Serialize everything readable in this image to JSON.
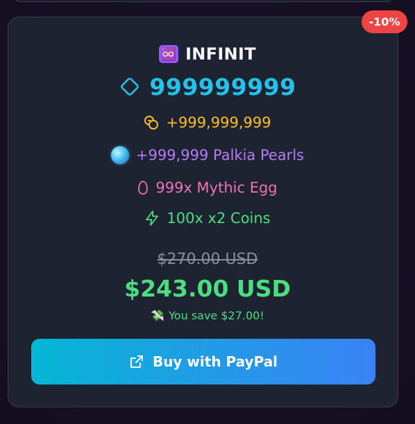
{
  "card": {
    "discount_badge": "-10%",
    "title_emoji": "♾️",
    "title": "INFINIT",
    "gems": "999999999",
    "coins": "+999,999,999",
    "pearls": "+999,999 Palkia Pearls",
    "eggs": "999x Mythic Egg",
    "multiplier": "100x x2 Coins",
    "old_price": "$270.00 USD",
    "new_price": "$243.00 USD",
    "savings_emoji": "💸",
    "savings": "You save $27.00!",
    "buy_button_label": "Buy with PayPal"
  },
  "icons": {
    "gems": "diamond-icon",
    "coins": "coins-icon",
    "pearls": "pearl-orb-icon",
    "eggs": "egg-icon",
    "multiplier": "lightning-icon",
    "buy": "external-link-icon"
  },
  "colors": {
    "accent_cyan": "#22c3ea",
    "coins_gold": "#fbbf24",
    "pearls_purple": "#b57cf7",
    "egg_pink": "#f072b6",
    "green": "#4ade80",
    "badge_red": "#ef4444",
    "button_gradient_start": "#06b6d4",
    "button_gradient_end": "#3b82f6"
  }
}
